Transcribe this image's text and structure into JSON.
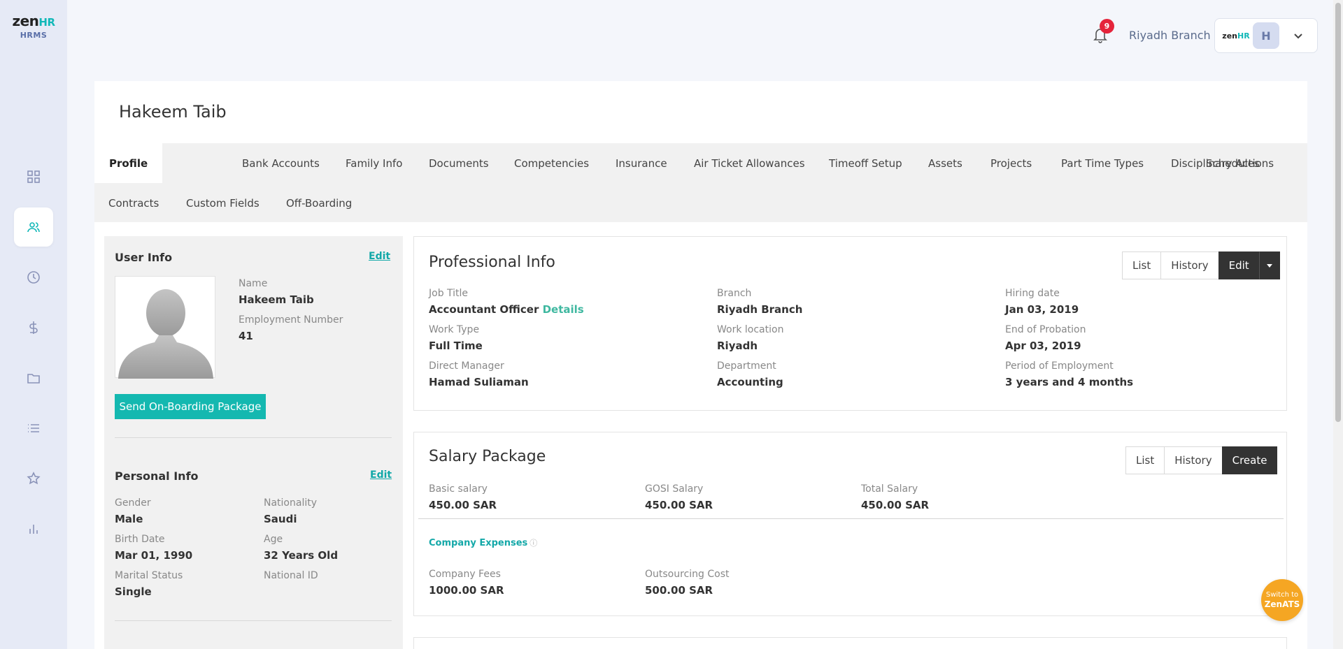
{
  "brand": {
    "logo_main": "zen",
    "logo_hr": "HR",
    "logo_sub": "HRMS"
  },
  "sidebar": {
    "items": [
      {
        "name": "dashboard",
        "icon": "grid-icon"
      },
      {
        "name": "employees",
        "icon": "users-icon",
        "active": true
      },
      {
        "name": "attendance",
        "icon": "clock-icon"
      },
      {
        "name": "payroll",
        "icon": "dollar-icon"
      },
      {
        "name": "documents",
        "icon": "folder-icon"
      },
      {
        "name": "lists",
        "icon": "list-icon"
      },
      {
        "name": "performance",
        "icon": "star-icon"
      },
      {
        "name": "reports",
        "icon": "bar-chart-icon"
      }
    ]
  },
  "topbar": {
    "notification_count": "9",
    "branch": "Riyadh Branch",
    "account_logo_main": "zen",
    "account_logo_hr": "HR",
    "avatar_initial": "H"
  },
  "employee": {
    "name": "Hakeem Taib"
  },
  "tabs": [
    "Profile",
    "Bank Accounts",
    "Family Info",
    "Documents",
    "Competencies",
    "Insurance",
    "Air Ticket Allowances",
    "Timeoff Setup",
    "Assets",
    "Projects",
    "Part Time Types",
    "Disciplinary Actions",
    "Schedules",
    "Contracts",
    "Custom Fields",
    "Off-Boarding"
  ],
  "user_info": {
    "title": "User Info",
    "edit": "Edit",
    "name_label": "Name",
    "name_value": "Hakeem Taib",
    "emp_no_label": "Employment Number",
    "emp_no_value": "41",
    "onboarding_button": "Send On-Boarding Package"
  },
  "personal_info": {
    "title": "Personal Info",
    "edit": "Edit",
    "gender_label": "Gender",
    "gender_value": "Male",
    "nationality_label": "Nationality",
    "nationality_value": "Saudi",
    "birth_label": "Birth Date",
    "birth_value": "Mar 01, 1990",
    "age_label": "Age",
    "age_value": "32 Years Old",
    "marital_label": "Marital Status",
    "marital_value": "Single",
    "national_id_label": "National ID"
  },
  "professional_info": {
    "title": "Professional Info",
    "buttons": {
      "list": "List",
      "history": "History",
      "edit": "Edit"
    },
    "job_title_label": "Job Title",
    "job_title_value": "Accountant Officer",
    "details_link": "Details",
    "branch_label": "Branch",
    "branch_value": "Riyadh Branch",
    "hiring_label": "Hiring date",
    "hiring_value": "Jan 03, 2019",
    "work_type_label": "Work Type",
    "work_type_value": "Full Time",
    "work_location_label": "Work location",
    "work_location_value": "Riyadh",
    "probation_label": "End of Probation",
    "probation_value": "Apr 03, 2019",
    "manager_label": "Direct Manager",
    "manager_value": "Hamad Suliaman",
    "department_label": "Department",
    "department_value": "Accounting",
    "period_label": "Period of Employment",
    "period_value": "3 years and 4 months"
  },
  "salary_package": {
    "title": "Salary Package",
    "buttons": {
      "list": "List",
      "history": "History",
      "create": "Create"
    },
    "basic_label": "Basic salary",
    "basic_value": "450.00 SAR",
    "gosi_label": "GOSI Salary",
    "gosi_value": "450.00 SAR",
    "total_label": "Total Salary",
    "total_value": "450.00 SAR",
    "company_expenses": "Company Expenses",
    "fees_label": "Company Fees",
    "fees_value": "1000.00 SAR",
    "outsourcing_label": "Outsourcing Cost",
    "outsourcing_value": "500.00 SAR"
  },
  "fab": {
    "line1": "Switch to",
    "line2": "ZenATS"
  }
}
